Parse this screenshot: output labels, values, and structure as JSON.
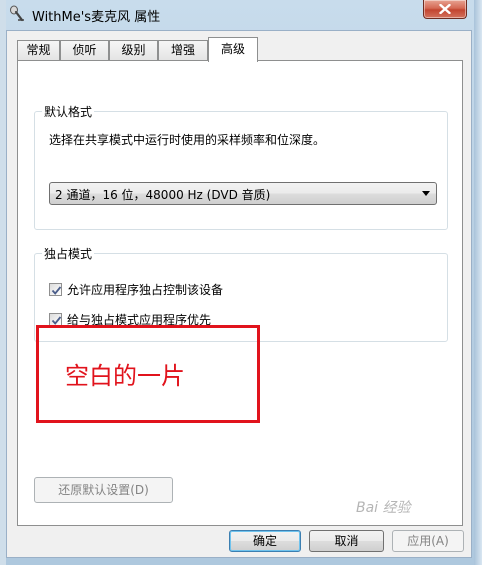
{
  "window": {
    "title": "WithMe's麦克风 属性"
  },
  "tabs": [
    {
      "label": "常规",
      "active": false
    },
    {
      "label": "侦听",
      "active": false
    },
    {
      "label": "级别",
      "active": false
    },
    {
      "label": "增强",
      "active": false
    },
    {
      "label": "高级",
      "active": true
    }
  ],
  "default_format": {
    "legend": "默认格式",
    "description": "选择在共享模式中运行时使用的采样频率和位深度。",
    "selected_format": "2 通道，16 位，48000 Hz (DVD 音质)"
  },
  "exclusive_mode": {
    "legend": "独占模式",
    "allow_exclusive_label": "允许应用程序独占控制该设备",
    "allow_exclusive_checked": true,
    "priority_label": "给与独占模式应用程序优先",
    "priority_checked": true
  },
  "annotation": {
    "text": "空白的一片",
    "color": "#e1131c"
  },
  "restore_defaults_label": "还原默认设置(D)",
  "buttons": {
    "ok": "确定",
    "cancel": "取消",
    "apply": "应用(A)"
  },
  "watermark": "Bai 经验"
}
